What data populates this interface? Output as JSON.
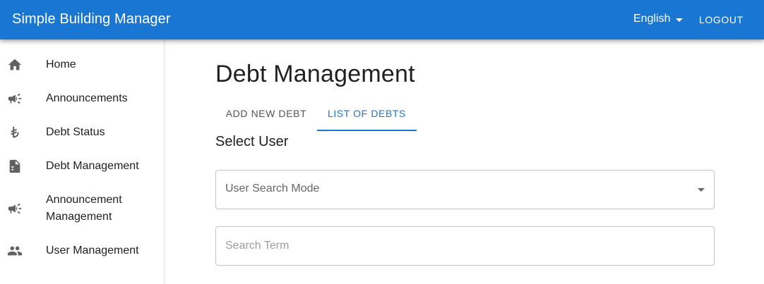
{
  "header": {
    "title": "Simple Building Manager",
    "language": "English",
    "logout_label": "LOGOUT"
  },
  "sidebar": {
    "items": [
      {
        "label": "Home",
        "icon": "home-icon"
      },
      {
        "label": "Announcements",
        "icon": "megaphone-icon"
      },
      {
        "label": "Debt Status",
        "icon": "lira-icon"
      },
      {
        "label": "Debt Management",
        "icon": "document-icon"
      },
      {
        "label": "Announcement Management",
        "icon": "megaphone-icon"
      },
      {
        "label": "User Management",
        "icon": "people-icon"
      }
    ]
  },
  "main": {
    "title": "Debt Management",
    "tabs": [
      {
        "label": "ADD NEW DEBT"
      },
      {
        "label": "LIST OF DEBTS"
      }
    ],
    "active_tab": "LIST OF DEBTS",
    "section_title": "Select User",
    "search_mode": {
      "label": "User Search Mode"
    },
    "search_term": {
      "placeholder": "Search Term"
    }
  },
  "colors": {
    "primary": "#1976d2",
    "appbar_text": "#ffffff",
    "icon": "#616161"
  }
}
